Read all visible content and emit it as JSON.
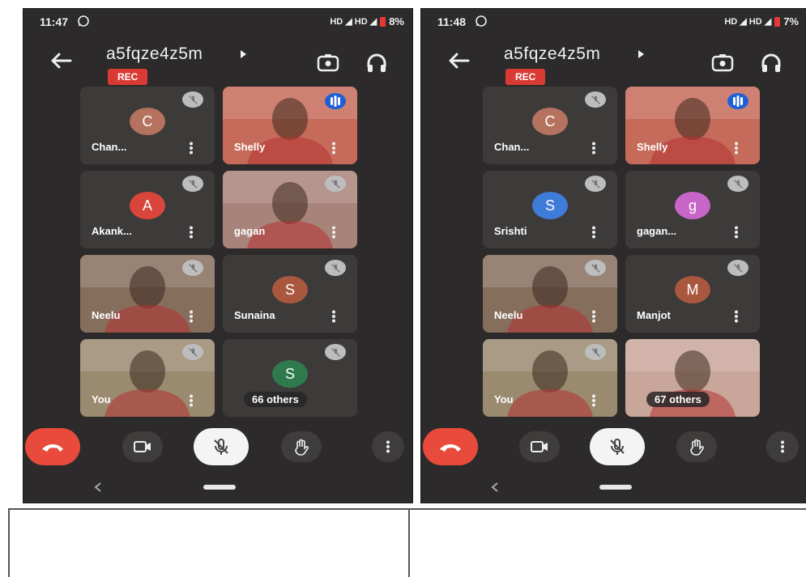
{
  "screens": [
    {
      "status": {
        "time": "11:47",
        "network": "HD ◢ HD ◢",
        "battery": "8%"
      },
      "meeting": {
        "code": "a5fqze4z5m",
        "rec_label": "REC"
      },
      "tiles": [
        {
          "name": "Chan...",
          "initial": "C",
          "avatar_color": "#b5735f",
          "kind": "avatar",
          "mic": "muted"
        },
        {
          "name": "Shelly",
          "kind": "video",
          "mic": "speaking",
          "video_tone": "#c66b5a"
        },
        {
          "name": "Akank...",
          "initial": "A",
          "avatar_color": "#d9453a",
          "kind": "avatar",
          "mic": "muted"
        },
        {
          "name": "gagan",
          "kind": "video",
          "mic": "muted",
          "video_tone": "#a8837a"
        },
        {
          "name": "Neelu",
          "kind": "video",
          "mic": "muted",
          "video_tone": "#866e5d"
        },
        {
          "name": "Sunaina",
          "initial": "S",
          "avatar_color": "#a9583f",
          "kind": "avatar",
          "mic": "muted"
        },
        {
          "name": "You",
          "kind": "video",
          "mic": "muted",
          "video_tone": "#9a8a70"
        },
        {
          "name": "",
          "initial": "S",
          "avatar_color": "#2f7a4d",
          "kind": "others",
          "mic": "muted",
          "others_label": "66 others"
        }
      ]
    },
    {
      "status": {
        "time": "11:48",
        "network": "HD ◢ HD ◢",
        "battery": "7%"
      },
      "meeting": {
        "code": "a5fqze4z5m",
        "rec_label": "REC"
      },
      "tiles": [
        {
          "name": "Chan...",
          "initial": "C",
          "avatar_color": "#b5735f",
          "kind": "avatar",
          "mic": "muted"
        },
        {
          "name": "Shelly",
          "kind": "video",
          "mic": "speaking",
          "video_tone": "#c66b5a"
        },
        {
          "name": "Srishti",
          "initial": "S",
          "avatar_color": "#3f7bd8",
          "kind": "avatar",
          "mic": "muted"
        },
        {
          "name": "gagan...",
          "initial": "g",
          "avatar_color": "#c766c6",
          "kind": "avatar",
          "mic": "muted"
        },
        {
          "name": "Neelu",
          "kind": "video",
          "mic": "muted",
          "video_tone": "#866e5d"
        },
        {
          "name": "Manjot",
          "initial": "M",
          "avatar_color": "#a9583f",
          "kind": "avatar",
          "mic": "muted"
        },
        {
          "name": "You",
          "kind": "video",
          "mic": "muted",
          "video_tone": "#9a8a70"
        },
        {
          "name": "",
          "kind": "others",
          "mic": "none",
          "others_label": "67 others",
          "video_tone": "#c9a69a"
        }
      ]
    }
  ],
  "icons": {
    "back": "arrow-left-icon",
    "switch_camera": "switch-camera-icon",
    "audio": "headphones-icon",
    "end_call": "phone-hangup-icon",
    "camera": "video-camera-icon",
    "mic": "mic-off-icon",
    "raise_hand": "hand-icon",
    "more": "more-vertical-icon"
  },
  "colors": {
    "background": "#2c2a2a",
    "tile": "#3d3a3a",
    "rec": "#d93a33",
    "end_call": "#e84a3c",
    "speaking": "#1e5fd8"
  }
}
